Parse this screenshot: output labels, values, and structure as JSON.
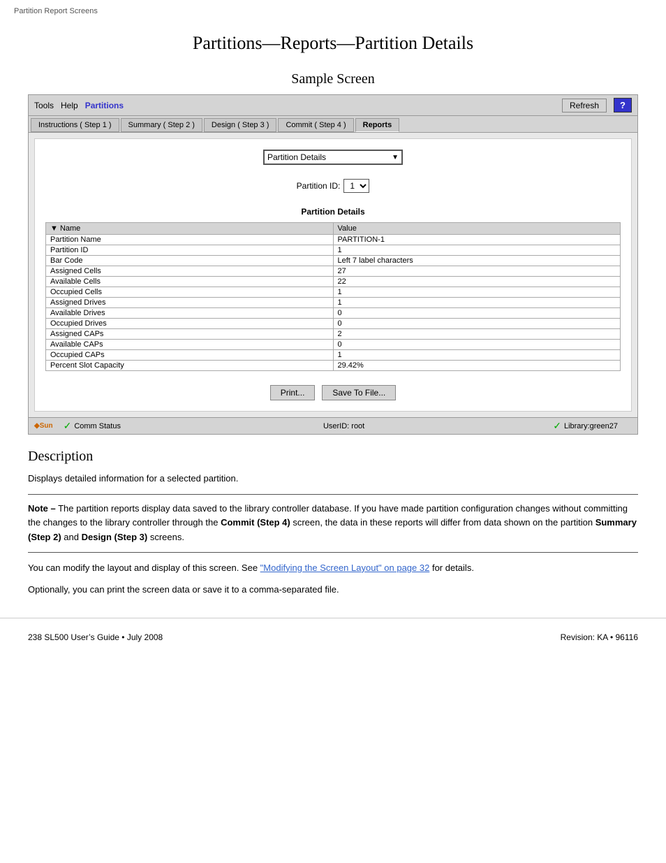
{
  "breadcrumb": "Partition Report Screens",
  "page_title": "Partitions—Reports—Partition Details",
  "sample_screen_title": "Sample Screen",
  "toolbar": {
    "tools_label": "Tools",
    "help_label": "Help",
    "partitions_label": "Partitions",
    "refresh_label": "Refresh",
    "help_btn_label": "?"
  },
  "tabs": [
    {
      "label": "Instructions ( Step 1 )",
      "active": false
    },
    {
      "label": "Summary ( Step 2 )",
      "active": false
    },
    {
      "label": "Design ( Step 3 )",
      "active": false
    },
    {
      "label": "Commit ( Step 4 )",
      "active": false
    },
    {
      "label": "Reports",
      "active": true
    }
  ],
  "dropdown": {
    "label": "Partition Details",
    "value": "Partition Details"
  },
  "partition_id_label": "Partition ID:",
  "partition_id_value": "1",
  "partition_details_title": "Partition Details",
  "table_headers": {
    "name": "Name",
    "value": "Value"
  },
  "table_rows": [
    {
      "name": "Partition Name",
      "value": "PARTITION-1"
    },
    {
      "name": "Partition ID",
      "value": "1"
    },
    {
      "name": "Bar Code",
      "value": "Left 7 label characters"
    },
    {
      "name": "Assigned Cells",
      "value": "27"
    },
    {
      "name": "Available Cells",
      "value": "22"
    },
    {
      "name": "Occupied Cells",
      "value": "1"
    },
    {
      "name": "Assigned Drives",
      "value": "1"
    },
    {
      "name": "Available Drives",
      "value": "0"
    },
    {
      "name": "Occupied Drives",
      "value": "0"
    },
    {
      "name": "Assigned CAPs",
      "value": "2"
    },
    {
      "name": "Available CAPs",
      "value": "0"
    },
    {
      "name": "Occupied CAPs",
      "value": "1"
    },
    {
      "name": "Percent Slot Capacity",
      "value": "29.42%"
    }
  ],
  "buttons": {
    "print_label": "Print...",
    "save_label": "Save To File..."
  },
  "status_bar": {
    "comm_status_label": "Comm Status",
    "user_id_label": "UserID: root",
    "library_label": "Library:green27"
  },
  "description": {
    "title": "Description",
    "text": "Displays detailed information for a selected partition.",
    "note_bold": "Note –",
    "note_text": " The partition reports display data saved to the library controller database. If you have made partition configuration changes without committing the changes to the library controller through the ",
    "commit_bold": "Commit (Step 4)",
    "note_text2": " screen, the data in these reports will differ from data shown on the partition ",
    "summary_bold": "Summary (Step 2)",
    "and_text": " and ",
    "design_bold": "Design (Step 3)",
    "note_end": " screens.",
    "modify_text": "You can modify the layout and display of this screen. See ",
    "link_text": "\"Modifying the Screen Layout\" on page 32",
    "modify_end": " for details.",
    "optional_text": "Optionally, you can print the screen data or save it to a comma-separated file."
  },
  "footer": {
    "left": "238   SL500 User’s Guide • July 2008",
    "right": "Revision: KA • 96116"
  }
}
